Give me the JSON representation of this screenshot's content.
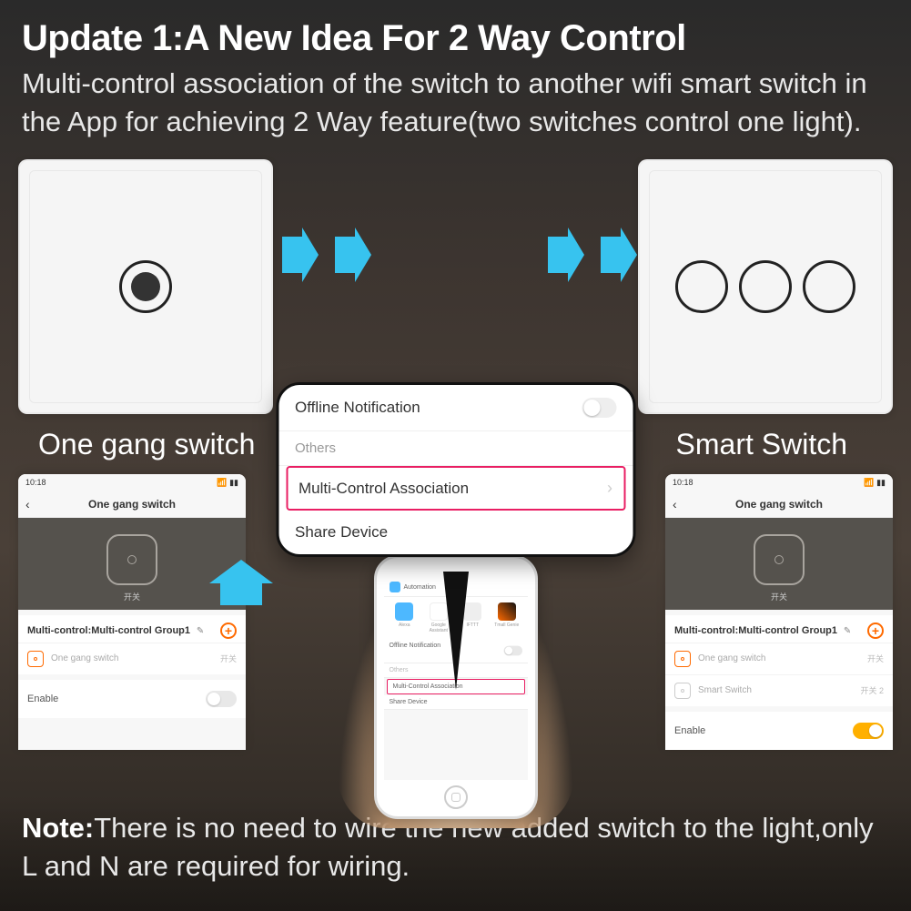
{
  "header": {
    "title_prefix": "Update 1:",
    "title_rest": "A New Idea For 2 Way Control",
    "subtitle": "Multi-control association of the switch to another wifi smart switch in the App for achieving 2 Way feature(two switches control one light)."
  },
  "labels": {
    "left_switch": "One gang switch",
    "right_switch": "Smart Switch"
  },
  "popover": {
    "row1": "Offline Notification",
    "others": "Others",
    "multi_control": "Multi-Control Association",
    "share": "Share Device"
  },
  "phone_left": {
    "time": "10:18",
    "signal": "",
    "title": "One gang switch",
    "device_label": "开关",
    "group_title": "Multi-control:Multi-control Group1",
    "item1": "One gang switch",
    "item1_sub": "开关",
    "enable": "Enable"
  },
  "phone_right": {
    "time": "10:18",
    "title": "One gang switch",
    "device_label": "开关",
    "group_title": "Multi-control:Multi-control Group1",
    "item1": "One gang switch",
    "item1_sub": "开关",
    "item2": "Smart Switch",
    "item2_sub": "开关 2",
    "enable": "Enable"
  },
  "held_phone": {
    "auto": "Automation",
    "alexa": "Alexa",
    "google": "Google Assistant",
    "ifttt": "IFTTT",
    "tmall": "Tmall Genie",
    "offline": "Offline Notification",
    "others": "Others",
    "multi": "Multi-Control Association",
    "share": "Share Device"
  },
  "note": {
    "prefix": "Note:",
    "text": "There is no need to wire the new added switch to the light,only L and N are required for wiring."
  }
}
